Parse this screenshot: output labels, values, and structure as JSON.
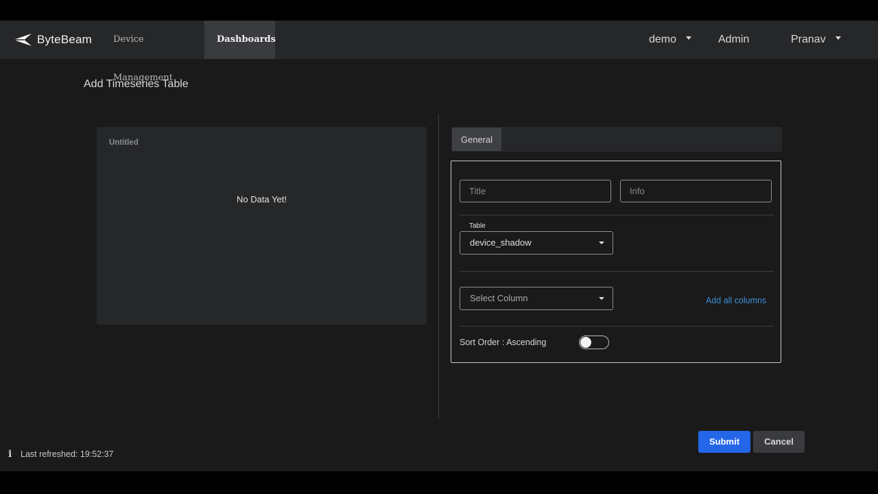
{
  "brand": {
    "name": "ByteBeam"
  },
  "nav": {
    "items": [
      {
        "label": "Device Management",
        "active": false
      },
      {
        "label": "Dashboards",
        "active": true
      }
    ],
    "project": "demo",
    "role": "Admin",
    "user": "Pranav"
  },
  "page": {
    "title": "Add Timeseries Table"
  },
  "preview": {
    "title": "Untitled",
    "empty_text": "No Data Yet!"
  },
  "tabs": [
    {
      "label": "General",
      "active": true
    }
  ],
  "form": {
    "title_placeholder": "Title",
    "info_placeholder": "Info",
    "table_label": "Table",
    "table_value": "device_shadow",
    "column_placeholder": "Select Column",
    "add_all_label": "Add all columns",
    "sort_order_label": "Sort Order : Ascending",
    "sort_order_ascending": false
  },
  "actions": {
    "submit_label": "Submit",
    "cancel_label": "Cancel"
  },
  "footer": {
    "last_refreshed": "Last refreshed: 19:52:37"
  },
  "colors": {
    "background": "#1a1a1b",
    "nav": "#262729",
    "accent_blue": "#2366e8",
    "link_blue": "#3b8fd6"
  }
}
